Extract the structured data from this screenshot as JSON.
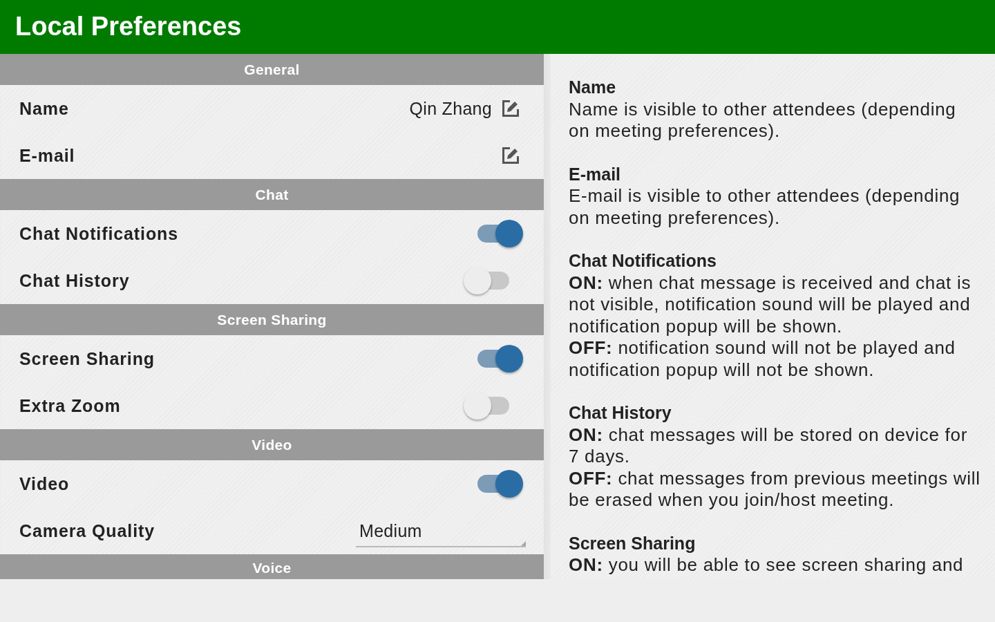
{
  "title": "Local Preferences",
  "sections": [
    {
      "heading": "General",
      "rows": [
        {
          "kind": "text",
          "label": "Name",
          "value": "Qin Zhang"
        },
        {
          "kind": "text",
          "label": "E-mail"
        }
      ]
    },
    {
      "heading": "Chat",
      "rows": [
        {
          "kind": "toggle",
          "label": "Chat Notifications",
          "on": true
        },
        {
          "kind": "toggle",
          "label": "Chat History",
          "on": false
        }
      ]
    },
    {
      "heading": "Screen Sharing",
      "rows": [
        {
          "kind": "toggle",
          "label": "Screen Sharing",
          "on": true
        },
        {
          "kind": "toggle",
          "label": "Extra Zoom",
          "on": false
        }
      ]
    },
    {
      "heading": "Video",
      "rows": [
        {
          "kind": "toggle",
          "label": "Video",
          "on": true
        },
        {
          "kind": "dropdown",
          "label": "Camera Quality",
          "value": "Medium"
        }
      ]
    },
    {
      "heading": "Voice"
    }
  ],
  "help": [
    {
      "heading": "Name",
      "paragraphs": [
        "Name is visible to other attendees (depending on meeting preferences)."
      ]
    },
    {
      "heading": "E-mail",
      "paragraphs": [
        "E-mail is visible to other attendees (depending on meeting preferences)."
      ]
    },
    {
      "heading": "Chat Notifications",
      "paragraphs": [
        "**ON:** when chat message is received and chat is not visible, notification sound will be played and notification popup will be shown.",
        "**OFF:** notification sound will not be played and notification popup will not be shown."
      ]
    },
    {
      "heading": "Chat History",
      "paragraphs": [
        "**ON:** chat messages will be stored on device for 7 days.",
        "**OFF:** chat messages from previous meetings will be erased when you join/host meeting."
      ]
    },
    {
      "heading": "Screen Sharing",
      "paragraphs": [
        "**ON:** you will be able to see screen sharing and"
      ]
    }
  ]
}
